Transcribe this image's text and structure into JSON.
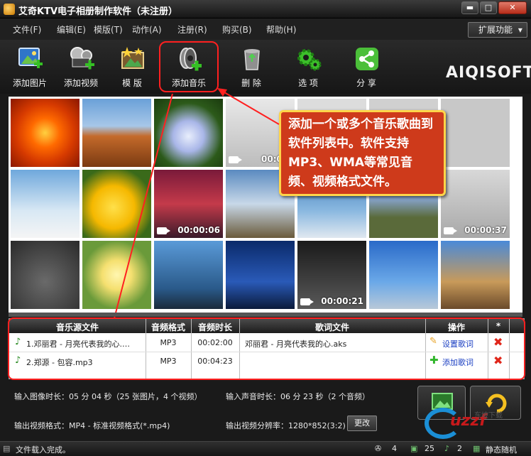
{
  "window": {
    "title": "艾奇KTV电子相册制作软件（未注册）",
    "min": "▬",
    "max": "□",
    "close": "✕"
  },
  "menu": {
    "items": [
      "文件(F)",
      "编辑(E)",
      "模版(T)",
      "动作(A)",
      "注册(R)",
      "购买(B)",
      "帮助(H)"
    ],
    "extend": "扩展功能",
    "extend_arrow": "▾"
  },
  "toolbar": {
    "add_image": "添加图片",
    "add_video": "添加视频",
    "template": "模 版",
    "add_music": "添加音乐",
    "delete": "删 除",
    "options": "选 项",
    "share": "分 享"
  },
  "logo": "AIQISOFT",
  "gallery": {
    "video_durations": [
      "00:02:",
      "00:00:06",
      "00:00:37",
      "00:00:21"
    ]
  },
  "callout": {
    "text": "添加一个或多个音乐歌曲到软件列表中。软件支持MP3、WMA等常见音频、视频格式文件。"
  },
  "music_list": {
    "columns": [
      "音乐源文件",
      "音频格式",
      "音频时长",
      "歌词文件",
      "操作",
      "*"
    ],
    "rows": [
      {
        "file": "1.邓丽君 - 月亮代表我的心.…",
        "format": "MP3",
        "duration": "00:02:00",
        "lyrics": "邓丽君 - 月亮代表我的心.aks",
        "action": "设置歌词"
      },
      {
        "file": "2.郑源 - 包容.mp3",
        "format": "MP3",
        "duration": "00:04:23",
        "lyrics": "",
        "action": "添加歌词"
      }
    ]
  },
  "info": {
    "image_duration": "输入图像时长：05 分 04 秒（25 张图片，4 个视频）",
    "audio_duration": "输入声音时长：06 分 23 秒（2 个音频）",
    "output_format": "输出视频格式：MP4 - 标准视频格式(*.mp4)",
    "output_resolution": "输出视频分辨率：1280*852(3:2)",
    "change": "更改"
  },
  "watermark": {
    "brand": "uzzf",
    "sub": "东坡下载"
  },
  "status": {
    "text": "文件载入完成。",
    "video_count": "4",
    "image_count": "25",
    "audio_count": "2",
    "mode": "静态随机"
  },
  "colors": {
    "accent_red": "#ff2020",
    "callout_bg": "#ce3a1b",
    "callout_border": "#ffd54a",
    "link_blue": "#1a3ec2"
  }
}
